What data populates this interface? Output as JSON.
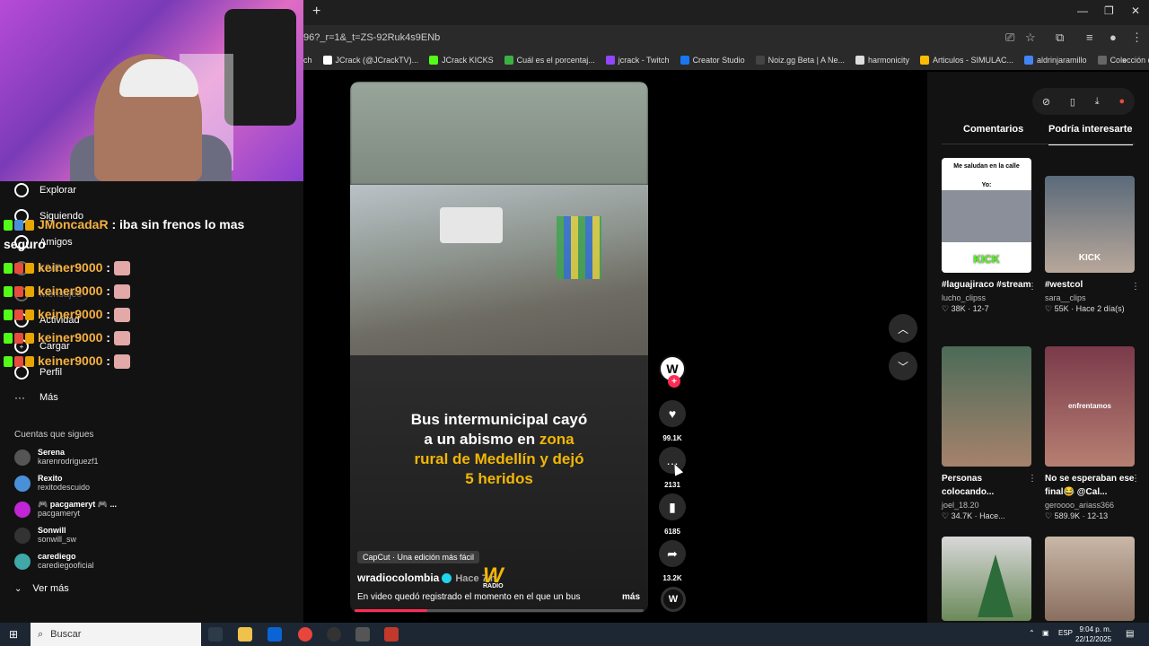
{
  "browser": {
    "url": "96?_r=1&_t=ZS-92Ruk4s9ENb",
    "newtab_label": "+",
    "bookmarks": [
      {
        "label": "ch"
      },
      {
        "label": "JCrack (@JCrackTV)..."
      },
      {
        "label": "JCrack KICKS"
      },
      {
        "label": "Cuál es el porcentaj..."
      },
      {
        "label": "jcrack - Twitch"
      },
      {
        "label": "Creator Studio"
      },
      {
        "label": "Noiz.gg Beta | A Ne..."
      },
      {
        "label": "harmonicity"
      },
      {
        "label": "Articulos - SIMULAC..."
      },
      {
        "label": "aldrinjaramillo"
      },
      {
        "label": "Colección de M_blei..."
      }
    ]
  },
  "sidebar": {
    "nav": [
      {
        "label": "Explorar"
      },
      {
        "label": "Siguiendo"
      },
      {
        "label": "Amigos"
      },
      {
        "label": "LIVE"
      },
      {
        "label": "Mensajes"
      },
      {
        "label": "Actividad"
      },
      {
        "label": "Cargar"
      },
      {
        "label": "Perfil"
      },
      {
        "label": "Más"
      }
    ],
    "following_title": "Cuentas que sigues",
    "following": [
      {
        "name": "Serena",
        "handle": "karenrodriguezf1",
        "color": "#555555"
      },
      {
        "name": "Rexito",
        "handle": "rexitodescuido",
        "color": "#4a90d9"
      },
      {
        "name": "🎮 pacgameryt 🎮 ...",
        "handle": "pacgameryt",
        "color": "#c026d3"
      },
      {
        "name": "Sonwill",
        "handle": "sonwill_sw",
        "color": "#333333"
      },
      {
        "name": "carediego",
        "handle": "carediegooficial",
        "color": "#3fa9a9"
      }
    ],
    "see_more": "Ver más"
  },
  "chat": [
    {
      "user": "JMoncadaR",
      "message": ": iba sin frenos lo mas",
      "cont": "seguro"
    },
    {
      "user": "keiner9000",
      "message": ":"
    },
    {
      "user": "keiner9000",
      "message": ":"
    },
    {
      "user": "keiner9000",
      "message": ":"
    },
    {
      "user": "keiner9000",
      "message": ":"
    },
    {
      "user": "keiner9000",
      "message": ":"
    }
  ],
  "video": {
    "headline_1": "Bus intermunicipal cayó",
    "headline_2": "a un abismo en ",
    "headline_hl_1": "zona",
    "headline_hl_2": "rural de Medellín y dejó",
    "headline_hl_3": "5 heridos",
    "capcut": "CapCut · Una edición más fácil",
    "author": "wradiocolombia",
    "time": "Hace 7 h",
    "description": "En video quedó registrado el momento en el que un bus",
    "more": "más",
    "watermark": "W",
    "watermark_sub": "RADIO",
    "progress": 0.25
  },
  "actions": {
    "avatar_letter": "W",
    "likes": "99.1K",
    "comments": "2131",
    "saves": "6185",
    "shares": "13.2K"
  },
  "right_panel": {
    "tab_comments": "Comentarios",
    "tab_suggested": "Podría interesarte",
    "cards": [
      {
        "title": "#laguajiraco #streamer #elto...",
        "author": "lucho_clipss",
        "likes": "38K",
        "date": "12-7",
        "thumb_text": "Me saludan en la calle",
        "thumb_sub": "Yo:",
        "thumb_logo": "KICK"
      },
      {
        "title": "#westcol",
        "author": "sara__clips",
        "likes": "55K",
        "date": "Hace 2 día(s)",
        "thumb_logo": "KICK"
      },
      {
        "title": "Personas colocando...",
        "author": "joel_18.20",
        "likes": "34.7K",
        "date": "Hace..."
      },
      {
        "title": "No se esperaban ese final😂 @Cal...",
        "author": "geroooo_ariass366",
        "likes": "589.9K",
        "date": "12-13",
        "thumb_label": "enfrentamos"
      },
      {
        "title": "",
        "author": "",
        "likes": "",
        "date": ""
      },
      {
        "title": "",
        "author": "",
        "likes": "",
        "date": ""
      }
    ]
  },
  "taskbar": {
    "search_placeholder": "Buscar",
    "lang": "ESP",
    "time": "9:04 p. m.",
    "date": "22/12/2025"
  }
}
